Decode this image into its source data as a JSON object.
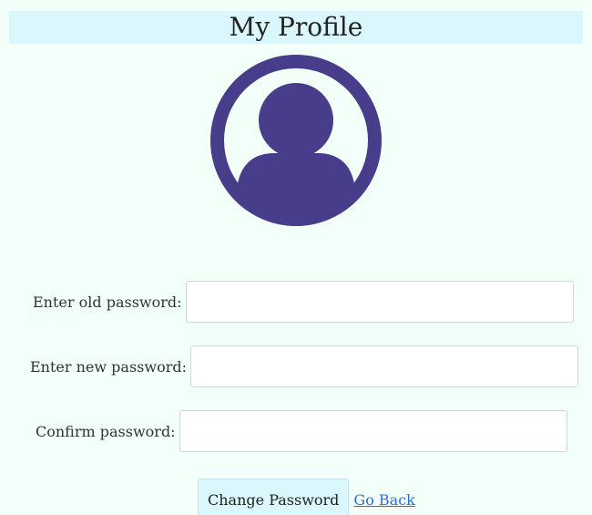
{
  "header": {
    "title": "My Profile"
  },
  "avatar": {
    "icon": "user-profile-icon",
    "color": "#473d8b"
  },
  "form": {
    "old_password": {
      "label": "Enter old password:",
      "value": "",
      "placeholder": ""
    },
    "new_password": {
      "label": "Enter new password:",
      "value": "",
      "placeholder": ""
    },
    "confirm_password": {
      "label": "Confirm password:",
      "value": "",
      "placeholder": ""
    }
  },
  "actions": {
    "change_password_label": "Change Password",
    "go_back_label": "Go Back"
  },
  "colors": {
    "background": "#f3fff9",
    "header_background": "#d9f7fc",
    "link": "#2b6fd6"
  }
}
